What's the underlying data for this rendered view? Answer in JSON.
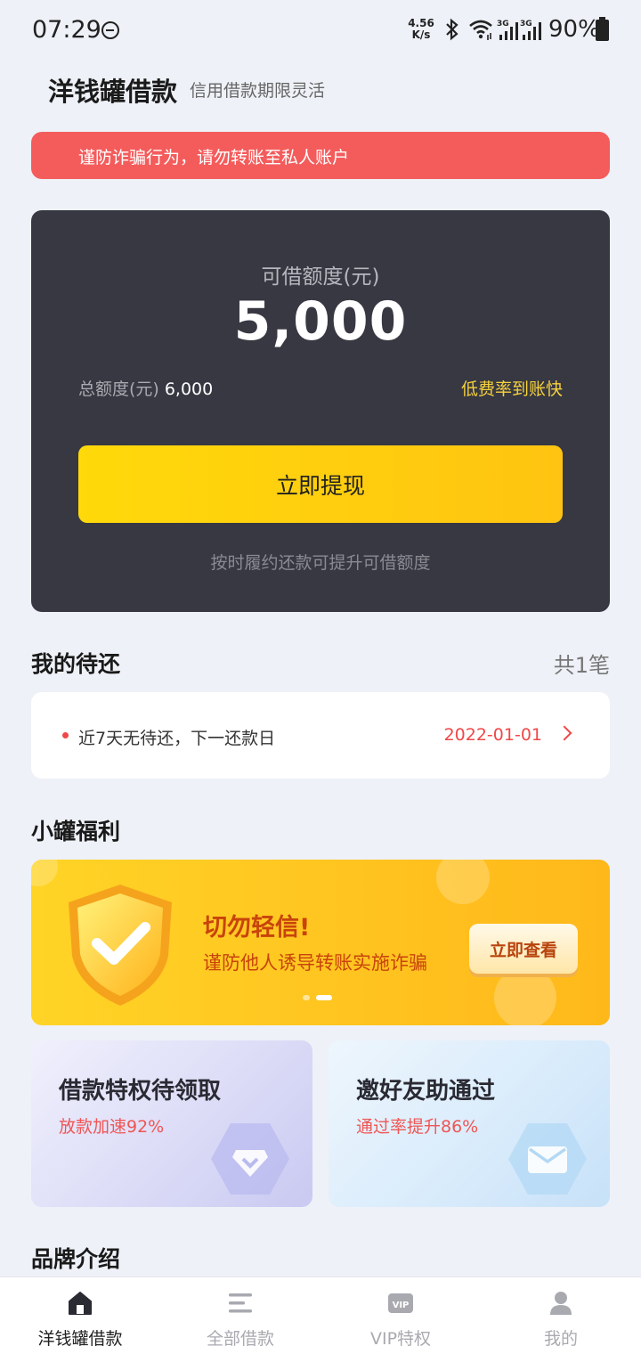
{
  "status_bar": {
    "time": "07:29",
    "net_speed_value": "4.56",
    "net_speed_unit": "K/s",
    "battery": "90%",
    "icons": [
      "do-not-disturb-icon",
      "bluetooth-icon",
      "wifi-icon",
      "signal-3g-icon",
      "signal-3g-icon",
      "battery-icon"
    ]
  },
  "header": {
    "title": "洋钱罐借款",
    "subtitle": "信用借款期限灵活"
  },
  "warning": {
    "text": "谨防诈骗行为，请勿转账至私人账户",
    "color": "#f45c5c"
  },
  "loan_card": {
    "available_label": "可借额度(元)",
    "available_amount": "5,000",
    "total_label": "总额度(元)",
    "total_amount": "6,000",
    "tag": "低费率到账快",
    "withdraw_button": "立即提现",
    "note": "按时履约还款可提升可借额度",
    "background": "#373842",
    "button_color": "#ffd000"
  },
  "pending": {
    "title": "我的待还",
    "count": "共1笔",
    "item_text": "近7天无待还，下一还款日",
    "next_date": "2022-01-01"
  },
  "welfare": {
    "title": "小罐福利",
    "banner": {
      "title": "切勿轻信!",
      "subtitle": "谨防他人诱导转账实施诈骗",
      "button": "立即查看",
      "active_slide": 2,
      "slide_count": 2
    },
    "cards": [
      {
        "title": "借款特权待领取",
        "subtitle": "放款加速92%",
        "icon": "diamond-icon"
      },
      {
        "title": "邀好友助通过",
        "subtitle": "通过率提升86%",
        "icon": "envelope-icon"
      }
    ]
  },
  "brand": {
    "title": "品牌介绍"
  },
  "tabbar": {
    "tabs": [
      {
        "label": "洋钱罐借款",
        "icon": "home-icon",
        "active": true
      },
      {
        "label": "全部借款",
        "icon": "list-icon",
        "active": false
      },
      {
        "label": "VIP特权",
        "icon": "vip-icon",
        "active": false
      },
      {
        "label": "我的",
        "icon": "profile-icon",
        "active": false
      }
    ]
  }
}
